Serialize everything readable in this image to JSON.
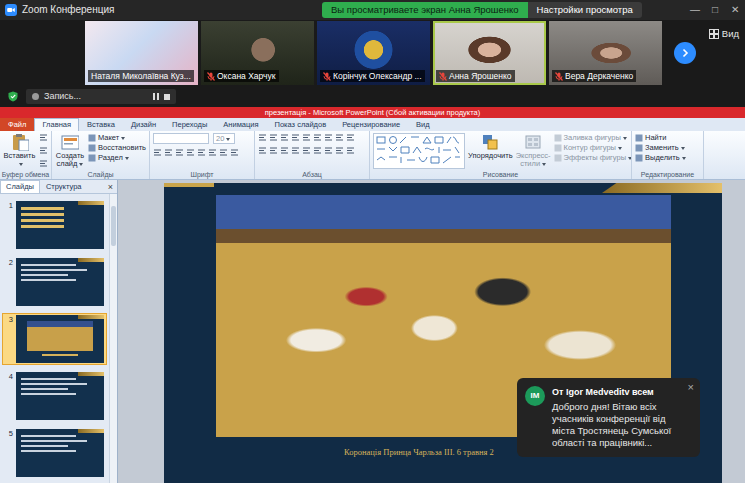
{
  "window": {
    "title": "Zoom Конференция",
    "controls": [
      "—",
      "□",
      "✕"
    ]
  },
  "share_banner": {
    "status": "Вы просматриваете экран Анна Ярошенко",
    "settings": "Настройки просмотра"
  },
  "participants": [
    {
      "name": "Наталя Миколаївна Куз...",
      "muted": false,
      "active": false
    },
    {
      "name": "Оксана Харчук",
      "muted": true,
      "active": false
    },
    {
      "name": "Корінчук Олександр ...",
      "muted": true,
      "active": false
    },
    {
      "name": "Анна Ярошенко",
      "muted": true,
      "active": true
    },
    {
      "name": "Вера Деркаченко",
      "muted": true,
      "active": false
    }
  ],
  "view_button": {
    "label": "Вид"
  },
  "recording": {
    "label": "Запись..."
  },
  "powerpoint": {
    "title": "презентація - Microsoft PowerPoint (Сбой активации продукта)",
    "tabs": [
      {
        "label": "Файл",
        "kind": "file",
        "selected": false
      },
      {
        "label": "Главная",
        "kind": "tab",
        "selected": true
      },
      {
        "label": "Вставка",
        "kind": "tab",
        "selected": false
      },
      {
        "label": "Дизайн",
        "kind": "tab",
        "selected": false
      },
      {
        "label": "Переходы",
        "kind": "tab",
        "selected": false
      },
      {
        "label": "Анимация",
        "kind": "tab",
        "selected": false
      },
      {
        "label": "Показ слайдов",
        "kind": "tab",
        "selected": false
      },
      {
        "label": "Рецензирование",
        "kind": "tab",
        "selected": false
      },
      {
        "label": "Вид",
        "kind": "tab",
        "selected": false
      }
    ],
    "ribbon": [
      {
        "label": "Буфер обмена",
        "kind": "clipboard",
        "buttons": [
          {
            "label": "Вставить",
            "kind": "large",
            "dropdown": true,
            "disabled": false
          }
        ]
      },
      {
        "label": "Слайды",
        "kind": "slides",
        "buttons": [
          {
            "label": "Создать слайд",
            "kind": "large",
            "dropdown": true,
            "disabled": false
          },
          {
            "label": "Макет",
            "kind": "small",
            "dropdown": true,
            "disabled": false
          },
          {
            "label": "Восстановить",
            "kind": "small",
            "dropdown": false,
            "disabled": false
          },
          {
            "label": "Раздел",
            "kind": "small",
            "dropdown": true,
            "disabled": false
          }
        ]
      },
      {
        "label": "Шрифт",
        "kind": "font",
        "buttons": [
          {
            "label": "20",
            "kind": "field",
            "dropdown": true,
            "disabled": true
          }
        ]
      },
      {
        "label": "Абзац",
        "kind": "paragraph",
        "buttons": []
      },
      {
        "label": "Рисование",
        "kind": "drawing",
        "buttons": [
          {
            "label": "Упорядочить",
            "kind": "large",
            "dropdown": false,
            "disabled": false
          },
          {
            "label": "Экспресс-стили",
            "kind": "large",
            "dropdown": true,
            "disabled": true
          },
          {
            "label": "Заливка фигуры",
            "kind": "small",
            "dropdown": true,
            "disabled": true
          },
          {
            "label": "Контур фигуры",
            "kind": "small",
            "dropdown": true,
            "disabled": true
          },
          {
            "label": "Эффекты фигуры",
            "kind": "small",
            "dropdown": true,
            "disabled": true
          }
        ]
      },
      {
        "label": "Редактирование",
        "kind": "editing",
        "buttons": [
          {
            "label": "Найти",
            "kind": "small",
            "dropdown": false,
            "disabled": false
          },
          {
            "label": "Заменить",
            "kind": "small",
            "dropdown": true,
            "disabled": false
          },
          {
            "label": "Выделить",
            "kind": "small",
            "dropdown": true,
            "disabled": false
          }
        ]
      }
    ],
    "panel": {
      "tabs": [
        {
          "label": "Слайды",
          "selected": true
        },
        {
          "label": "Структура",
          "selected": false
        }
      ],
      "close": "×"
    },
    "slides": [
      {
        "number": "1",
        "kind": "title",
        "selected": false
      },
      {
        "number": "2",
        "kind": "text",
        "selected": false
      },
      {
        "number": "3",
        "kind": "photo",
        "selected": true
      },
      {
        "number": "4",
        "kind": "text",
        "selected": false
      },
      {
        "number": "5",
        "kind": "text",
        "selected": false
      }
    ],
    "current_slide": {
      "caption": "Коронація Принца Чарльза III. 6 травня 2"
    }
  },
  "chat_toast": {
    "avatar": "IM",
    "sender": "От Igor Medveditv всем",
    "message": "Доброго дня! Вітаю всіх учасників конференції від міста Тростянець Сумської області та працівникі...",
    "close": "×"
  }
}
